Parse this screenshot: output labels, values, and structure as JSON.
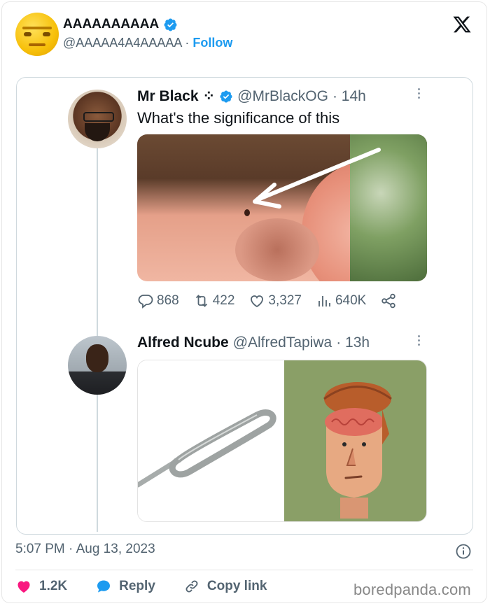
{
  "author": {
    "name": "AAAAAAAAAA",
    "handle": "@AAAAA4A4AAAAA",
    "separator": "·",
    "follow_label": "Follow",
    "avatar_icon": "smiling-emoji-face",
    "verified_icon": "verified-badge"
  },
  "brand": {
    "logo_icon": "x-logo"
  },
  "thread": [
    {
      "name": "Mr Black",
      "name_suffix": "⁘",
      "handle": "@MrBlackOG",
      "time": "· 14h",
      "text": "What's the significance of this",
      "image_icon": "ear-with-preauricular-pit-photo",
      "actions": {
        "replies": "868",
        "reposts": "422",
        "likes": "3,327",
        "views": "640K"
      }
    },
    {
      "name": "Alfred Ncube",
      "handle": "@AlfredTapiwa",
      "time": "· 13h",
      "image_left_icon": "sim-ejector-pin",
      "image_right_icon": "open-head-brain-cartoon"
    }
  ],
  "post": {
    "timestamp": "5:07 PM · Aug 13, 2023",
    "likes": "1.2K",
    "reply_label": "Reply",
    "copy_link_label": "Copy link"
  },
  "watermark": "boredpanda.com",
  "colors": {
    "accent": "#1d9bf0",
    "like": "#f91880",
    "muted": "#536471",
    "text": "#0f1419"
  }
}
